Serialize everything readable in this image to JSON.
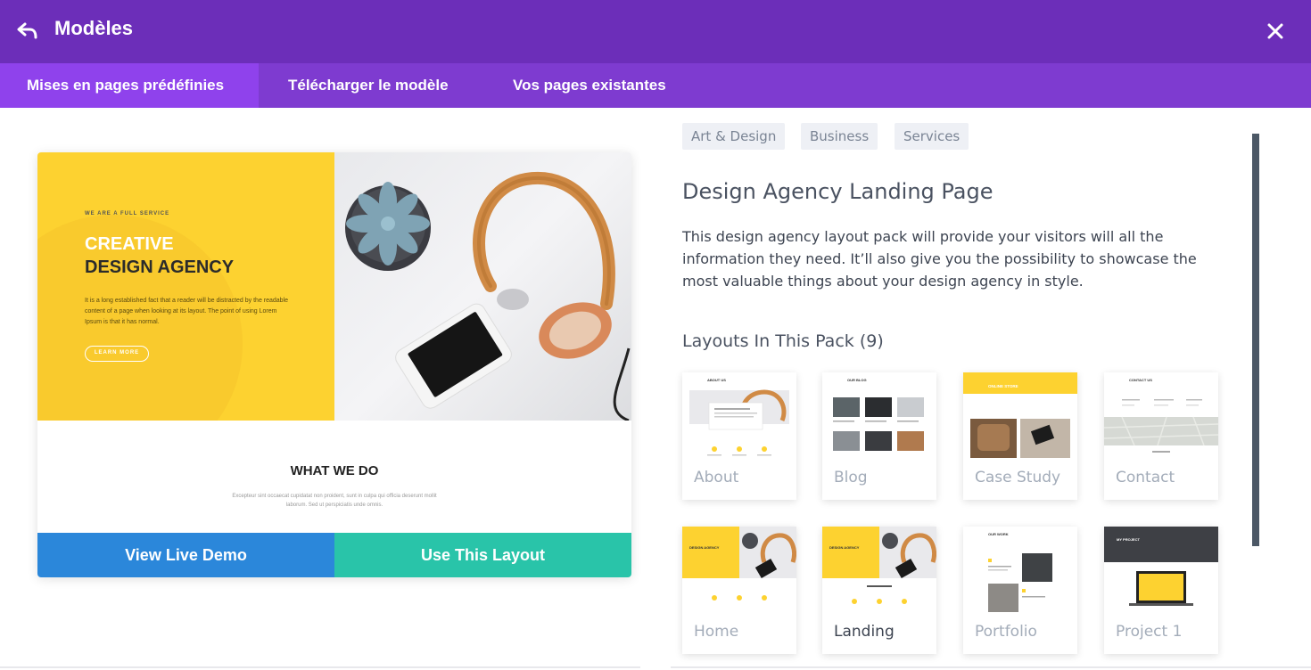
{
  "header": {
    "title": "Modèles"
  },
  "tabs": [
    {
      "label": "Mises en pages prédéfinies",
      "active": true
    },
    {
      "label": "Télécharger le modèle",
      "active": false
    },
    {
      "label": "Vos pages existantes",
      "active": false
    }
  ],
  "preview": {
    "kicker": "WE ARE A FULL SERVICE",
    "headline_1": "CREATIVE",
    "headline_2": "DESIGN AGENCY",
    "body": "It is a long established fact that a reader will be distracted by the readable content of a page when looking at its layout. The point of using Lorem Ipsum is that it has normal.",
    "button": "LEARN MORE",
    "section_title": "WHAT WE DO",
    "section_body": "Excepteur sint occaecat cupidatat non proident, sunt in culpa qui officia deserunt mollit laborum. Sed ut perspiciatis unde omnis."
  },
  "buttons": {
    "demo": "View Live Demo",
    "use": "Use This Layout"
  },
  "tags": [
    "Art & Design",
    "Business",
    "Services"
  ],
  "pack": {
    "title": "Design Agency Landing Page",
    "description": "This design agency layout pack will provide your visitors will all the information they need. It’ll also give you the possibility to showcase the most valuable things about your design agency in style.",
    "layouts_title": "Layouts In This Pack (9)"
  },
  "layouts": [
    {
      "label": "About",
      "mini_title": "ABOUT US"
    },
    {
      "label": "Blog",
      "mini_title": "OUR BLOG"
    },
    {
      "label": "Case Study",
      "mini_title": "ONLINE STORE"
    },
    {
      "label": "Contact",
      "mini_title": "CONTACT US"
    },
    {
      "label": "Home",
      "mini_title": "DESIGN AGENCY"
    },
    {
      "label": "Landing",
      "mini_title": "DESIGN AGENCY"
    },
    {
      "label": "Portfolio",
      "mini_title": "OUR WORK"
    },
    {
      "label": "Project 1",
      "mini_title": "MY PROJECT"
    }
  ],
  "colors": {
    "header": "#6c2eb9",
    "tabs": "#7e3bd0",
    "active_tab": "#8f42ec",
    "demo_button": "#2b87da",
    "use_button": "#29c4a9",
    "hero_yellow": "#fdd230"
  },
  "icons": {
    "back": "back-arrow-icon",
    "close": "close-icon"
  }
}
